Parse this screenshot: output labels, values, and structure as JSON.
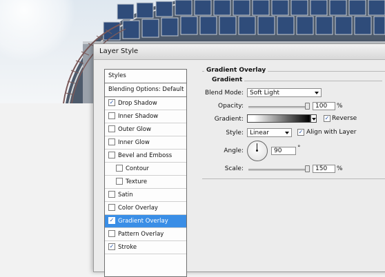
{
  "dialog": {
    "title": "Layer Style"
  },
  "left_panel": {
    "items": [
      {
        "label": "Styles",
        "type": "header"
      },
      {
        "label": "Blending Options: Default",
        "type": "header"
      },
      {
        "label": "Drop Shadow",
        "checked": true
      },
      {
        "label": "Inner Shadow",
        "checked": false
      },
      {
        "label": "Outer Glow",
        "checked": false
      },
      {
        "label": "Inner Glow",
        "checked": false
      },
      {
        "label": "Bevel and Emboss",
        "checked": false
      },
      {
        "label": "Contour",
        "checked": false
      },
      {
        "label": "Texture",
        "checked": false
      },
      {
        "label": "Satin",
        "checked": false
      },
      {
        "label": "Color Overlay",
        "checked": false
      },
      {
        "label": "Gradient Overlay",
        "checked": true,
        "selected": true
      },
      {
        "label": "Pattern Overlay",
        "checked": false
      },
      {
        "label": "Stroke",
        "checked": true
      }
    ]
  },
  "gradient_overlay": {
    "section_title": "Gradient Overlay",
    "subsection_title": "Gradient",
    "blend_mode": {
      "label": "Blend Mode:",
      "value": "Soft Light"
    },
    "opacity": {
      "label": "Opacity:",
      "value": "100",
      "unit": "%",
      "level_percent": 100
    },
    "gradient": {
      "label": "Gradient:",
      "reverse_label": "Reverse",
      "reverse_checked": true
    },
    "style": {
      "label": "Style:",
      "value": "Linear",
      "align_label": "Align with Layer",
      "align_checked": true
    },
    "angle": {
      "label": "Angle:",
      "value": "90",
      "unit": "°"
    },
    "scale": {
      "label": "Scale:",
      "value": "150",
      "unit": "%",
      "level_percent": 100
    }
  },
  "checkmark": "✓"
}
